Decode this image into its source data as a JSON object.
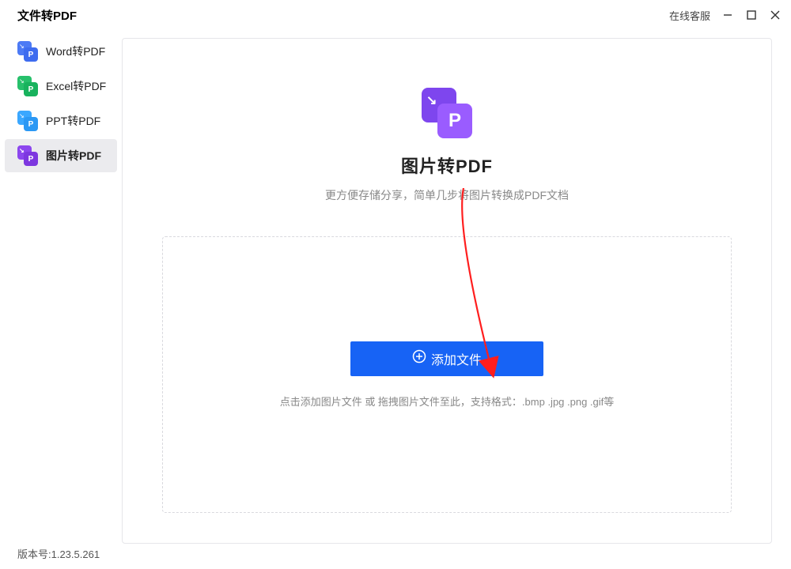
{
  "titlebar": {
    "title": "文件转PDF",
    "help_link": "在线客服"
  },
  "sidebar": {
    "items": [
      {
        "label": "Word转PDF",
        "letter": "P",
        "color_back": "#4c7af5",
        "color_front": "#3e6cef"
      },
      {
        "label": "Excel转PDF",
        "letter": "P",
        "color_back": "#27c06b",
        "color_front": "#18b25d"
      },
      {
        "label": "PPT转PDF",
        "letter": "P",
        "color_back": "#3aa7ff",
        "color_front": "#2b98f4"
      },
      {
        "label": "图片转PDF",
        "letter": "P",
        "color_back": "#8c46ee",
        "color_front": "#7d37df"
      }
    ],
    "active_index": 3
  },
  "main": {
    "hero_icon": {
      "letter": "P",
      "color_back": "#7e46ee",
      "color_front": "#9a5cff"
    },
    "title": "图片转PDF",
    "description": "更方便存储分享，简单几步将图片转换成PDF文档",
    "add_button": "添加文件",
    "dropzone_hint": "点击添加图片文件 或 拖拽图片文件至此，支持格式：.bmp .jpg .png .gif等"
  },
  "footer": {
    "version": "版本号:1.23.5.261"
  }
}
